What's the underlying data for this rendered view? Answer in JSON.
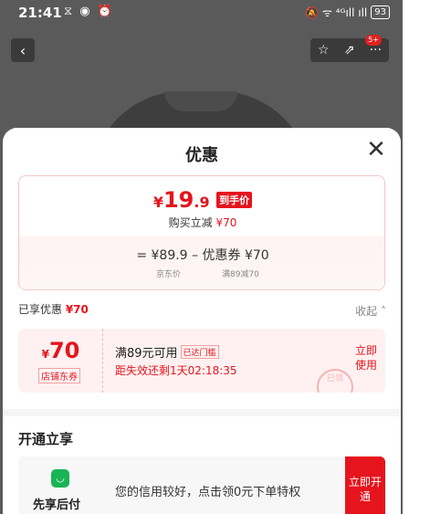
{
  "status_bar": {
    "time": "21:41",
    "left_icons": "⧖ ◉ ⏰",
    "right_icons": "🔕 ᯤ ⁴ᴳıll ıll",
    "battery": "93"
  },
  "nav": {
    "back_icon": "‹",
    "star_icon": "☆",
    "share_icon": "⇗",
    "more_icon": "···",
    "more_badge": "5+"
  },
  "sheet": {
    "title": "优惠",
    "close_icon": "✕"
  },
  "price": {
    "yen": "¥",
    "integer": "19",
    "decimal": ".9",
    "tag": "到手价",
    "reduce_text": "购买立减 ",
    "reduce_amount": "¥70",
    "formula": "=  ¥89.9  –  优惠券 ¥70",
    "jd_price_label": "京东价",
    "coupon_label": "满89减70"
  },
  "enjoyed": {
    "text": "已享优惠 ",
    "amount": "¥70",
    "collapse": "收起 ˄"
  },
  "coupon": {
    "yen": "¥",
    "value": "70",
    "type": "店铺东券",
    "condition": "满89元可用",
    "threshold_tag": "已达门槛",
    "expire": "距失效还剩1天02:18:35",
    "use_button": "立即使用",
    "stamp": "已领"
  },
  "open_section": {
    "title": "开通立享",
    "paylater_icon": "◡",
    "paylater_name": "先享后付",
    "paylater_desc": "您的信用较好，点击领0元下单特权",
    "open_button": "立即开通"
  },
  "colors": {
    "accent_red": "#e5141d",
    "pay_green": "#19b455"
  }
}
